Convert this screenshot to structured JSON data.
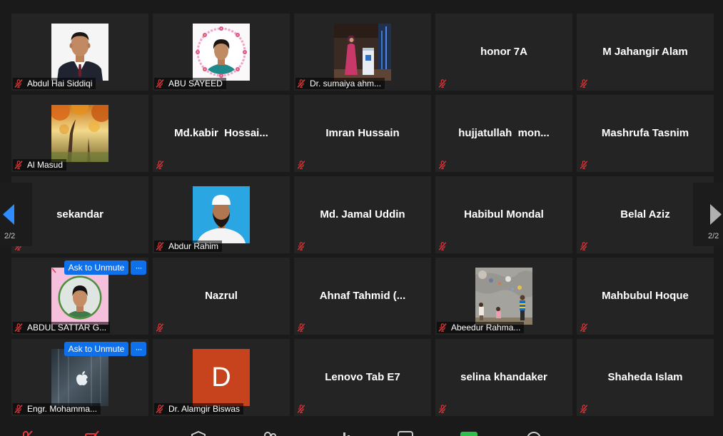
{
  "pagination": {
    "left": "2/2",
    "right": "2/2"
  },
  "controls": {
    "ask_to_unmute": "Ask to Unmute",
    "more": "···"
  },
  "participants": [
    {
      "name": "Abdul Hai Siddiqi",
      "muted": true
    },
    {
      "name": "ABU SAYEED",
      "muted": true
    },
    {
      "name": "Dr. sumaiya ahm...",
      "muted": true
    },
    {
      "name": "honor 7A",
      "muted": true
    },
    {
      "name": "M Jahangir Alam",
      "muted": true
    },
    {
      "name": "Al Masud",
      "muted": true
    },
    {
      "name": "Md.kabir  Hossai...",
      "muted": true
    },
    {
      "name": "Imran Hussain",
      "muted": true
    },
    {
      "name": "hujjatullah  mon...",
      "muted": true
    },
    {
      "name": "Mashrufa Tasnim",
      "muted": true
    },
    {
      "name": "sekandar",
      "muted": true
    },
    {
      "name": "Abdur Rahim",
      "muted": true
    },
    {
      "name": "Md. Jamal Uddin",
      "muted": true
    },
    {
      "name": "Habibul Mondal",
      "muted": true
    },
    {
      "name": "Belal Aziz",
      "muted": true
    },
    {
      "name": "ABDUL SATTAR G...",
      "muted": true
    },
    {
      "name": "Nazrul",
      "muted": true
    },
    {
      "name": "Ahnaf Tahmid (...",
      "muted": true
    },
    {
      "name": "Abeedur Rahma...",
      "muted": true
    },
    {
      "name": "Mahbubul Hoque",
      "muted": true
    },
    {
      "name": "Engr. Mohamma...",
      "muted": true
    },
    {
      "name": "Dr. Alamgir Biswas",
      "muted": true,
      "initial": "D"
    },
    {
      "name": "Lenovo Tab E7",
      "muted": true
    },
    {
      "name": "selina khandaker",
      "muted": true
    },
    {
      "name": "Shaheda Islam",
      "muted": true
    }
  ],
  "toolbar": {
    "items": [
      {
        "icon": "unmute-icon"
      },
      {
        "icon": "start-video-icon"
      },
      {
        "icon": "security-icon"
      },
      {
        "icon": "participants-icon"
      },
      {
        "icon": "polls-icon"
      },
      {
        "icon": "chat-icon"
      },
      {
        "icon": "share-screen-icon"
      },
      {
        "icon": "record-icon"
      }
    ]
  },
  "icons": {
    "muted": "mic-muted-icon",
    "previous": "arrow-left-icon",
    "next": "arrow-right-icon"
  },
  "colors": {
    "background": "#1a1a1a",
    "tile": "#242424",
    "accent": "#0e71eb",
    "muted": "#e0393e",
    "avatar_initial_bg": "#c6431d",
    "nav_active": "#2d8cff",
    "nav_inactive": "#b0b0b0"
  }
}
